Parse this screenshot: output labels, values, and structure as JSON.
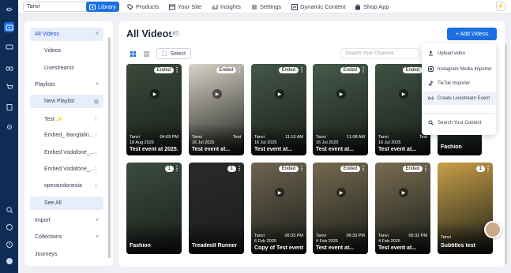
{
  "topbar": {
    "account": "Tanvi",
    "tabs": [
      {
        "label": "Library",
        "icon": "library-icon",
        "active": true
      },
      {
        "label": "Products",
        "icon": "tag-icon"
      },
      {
        "label": "Your Site",
        "icon": "site-icon"
      },
      {
        "label": "Insights",
        "icon": "chart-icon"
      },
      {
        "label": "Settings",
        "icon": "sliders-icon"
      },
      {
        "label": "Dynamic Content",
        "icon": "dynamic-icon"
      },
      {
        "label": "Shop App",
        "icon": "bag-icon"
      }
    ]
  },
  "sidebar": {
    "items": [
      {
        "label": "All Videos",
        "chev": "˄"
      },
      {
        "label": "Videos"
      },
      {
        "label": "Livestreams"
      },
      {
        "label": "Playlists",
        "chev": "˄"
      },
      {
        "label": "New Playlist",
        "right": "⊞"
      },
      {
        "label": "Test ✨",
        "right": "⋮"
      },
      {
        "label": "Embed_ Banglalin...",
        "right": "⋮"
      },
      {
        "label": "Embed Vodafone_...",
        "right": "⋮"
      },
      {
        "label": "Embed Vodafone_...",
        "right": "⋮"
      },
      {
        "label": "operaindonesia",
        "right": "⋮"
      },
      {
        "label": "See All"
      },
      {
        "label": "Import",
        "chev": "˅"
      },
      {
        "label": "Collections",
        "chev": "˅"
      },
      {
        "label": "Journeys"
      }
    ]
  },
  "main": {
    "title": "All Videos",
    "count": "67",
    "add_label": "+ Add Videos",
    "select_label": "Select",
    "search_placeholder": "Search Your Channel",
    "cards": [
      {
        "badge": "Ended",
        "who": "Tanvi",
        "date": "18 Aug 2025",
        "right": "04:09 PM",
        "name": "Test event at 2025...",
        "bg": "#3a4a3c"
      },
      {
        "badge": "Ended",
        "who": "Tanvi",
        "date": "16 Jul 2025",
        "right": "Test",
        "name": "Test event at...",
        "bg": "#d9d3c8"
      },
      {
        "badge": "Ended",
        "who": "Tanvi",
        "date": "16 Jul 2025",
        "right": "11:15 AM",
        "name": "Test event at...",
        "bg": "#44564a"
      },
      {
        "badge": "Ended",
        "who": "Tanvi",
        "date": "16 Jul 2025",
        "right": "11:08 AM",
        "name": "Test event at...",
        "bg": "#465a4b"
      },
      {
        "badge": "Ended",
        "who": "Tanvi",
        "date": "16 Jul 2025",
        "right": "Test",
        "name": "Test event at...",
        "bg": "#3f5244"
      },
      {
        "badge": "",
        "who": "",
        "date": "",
        "right": "",
        "name": "Fashion",
        "bg": "#4a5d4f"
      },
      {
        "badge": "1",
        "who": "",
        "date": "",
        "right": "",
        "name": "Fashion",
        "bg": "#3b4c3f"
      },
      {
        "badge": "1",
        "who": "",
        "date": "",
        "right": "",
        "name": "Treadmill Runner",
        "bg": "#2a2a2a"
      },
      {
        "badge": "Ended",
        "who": "Tanvi",
        "date": "6 Feb 2025",
        "right": "06:33 PM",
        "name": "Copy of Test event...",
        "bg": "#6f6450"
      },
      {
        "badge": "Ended",
        "who": "Tanvi",
        "date": "4 Feb 2025",
        "right": "06:33 PM",
        "name": "Test event at...",
        "bg": "#76694f"
      },
      {
        "badge": "Ended",
        "who": "Tanvi",
        "date": "4 Feb 2025",
        "right": "06:32 PM",
        "name": "Test event at...",
        "bg": "#7a6c52"
      },
      {
        "badge": "1",
        "who": "Tanvi",
        "date": "",
        "right": "",
        "name": "Subtitles test",
        "bg": "#c89f47"
      }
    ]
  },
  "dropdown": {
    "items": [
      {
        "label": "Upload video",
        "icon": "upload-icon"
      },
      {
        "label": "Instagram Media Importer",
        "icon": "instagram-icon"
      },
      {
        "label": "TikTok Importer",
        "icon": "tiktok-icon"
      },
      {
        "label": "Create Livestream Event",
        "icon": "livestream-icon"
      },
      {
        "label": "Search Your Content",
        "icon": "search-icon"
      }
    ]
  },
  "colors": {
    "accent": "#1b6fe0",
    "rail": "#0d2d57"
  }
}
